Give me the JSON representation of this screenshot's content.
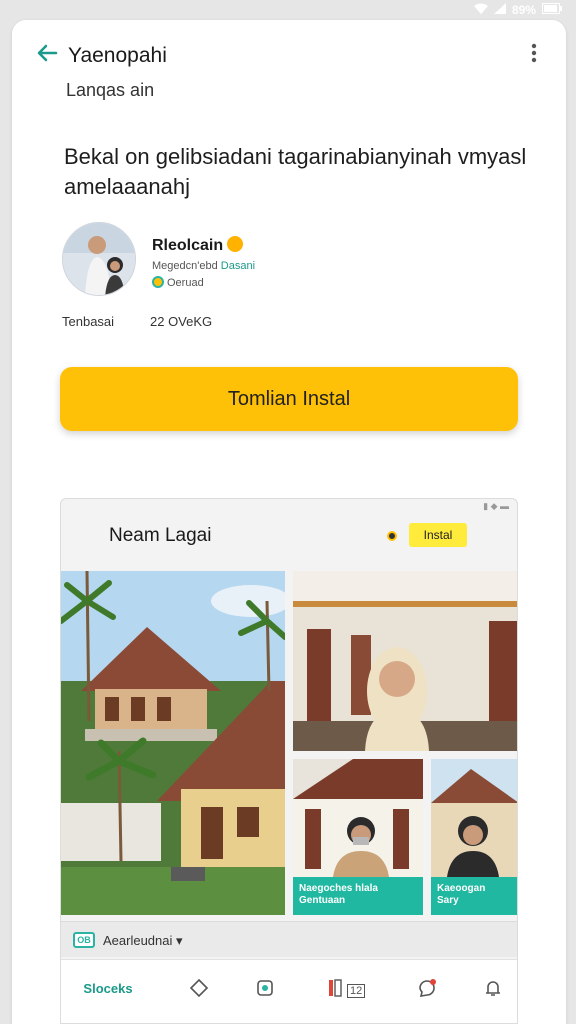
{
  "status_bar": {
    "battery": "89%"
  },
  "header": {
    "back_icon": "arrow-left-icon",
    "title": "Yaenopahi",
    "more_icon": "kebab-menu-icon"
  },
  "subtitle": "Lanqas ain",
  "headline": "Bekal on gelibsiadani tagarinabianyinah vmyasl amelaaanahj",
  "developer": {
    "name": "Rleolcain",
    "meta_prefix": "Megedcn'ebd ",
    "meta_link": "Dasani",
    "badge": "Oeruad"
  },
  "stats": {
    "left": "Tenbasai",
    "right": "22 OVeKG"
  },
  "install_button": "Tomlian Instal",
  "preview": {
    "title": "Neam Lagai",
    "install": "Instal",
    "captions": [
      {
        "line1": "Naegoches hlala",
        "line2": "Gentuaan"
      },
      {
        "line1": "Kaeoogan",
        "line2": "Sary"
      }
    ],
    "chip_badge": "OB",
    "chip_label": "Aearleudnai"
  },
  "bottom_nav": {
    "brand": "Sloceks",
    "counter": "12",
    "icons": [
      "diamond-icon",
      "image-icon",
      "book-icon",
      "chat-icon",
      "bell-icon"
    ]
  },
  "colors": {
    "accent": "#ffc107",
    "teal": "#1a9a8a",
    "caption": "#20b8a0"
  }
}
